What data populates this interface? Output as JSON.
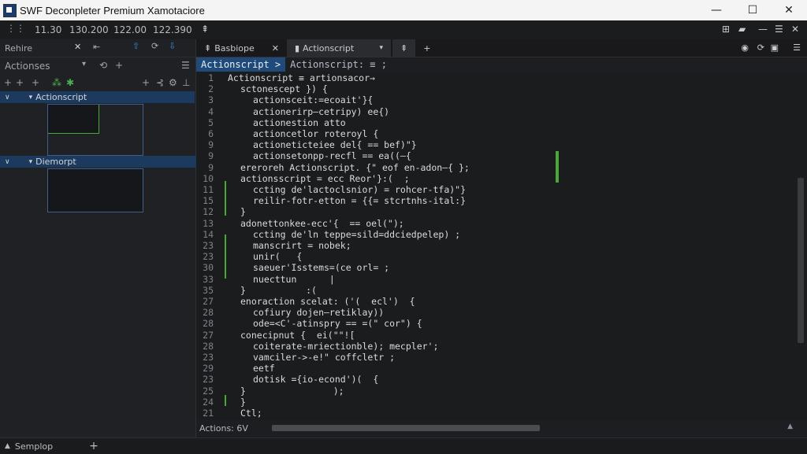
{
  "window": {
    "title": "SWF Deconpleter Premium Xamotaciore",
    "minimize": "—",
    "maximize": "☐",
    "close": "✕"
  },
  "topbar": {
    "t1": "11.30",
    "t2": "130.200",
    "t3": "122.00",
    "t4": "122.390"
  },
  "left_panel": {
    "tab_label": "Rehire",
    "section_label": "Actionses",
    "tree": [
      {
        "label": "Actionscript",
        "selected": true
      },
      {
        "label": "Diemorpt",
        "selected": true
      }
    ]
  },
  "editor": {
    "tabs": [
      {
        "label": "Basbiope"
      },
      {
        "label": "Actionscript"
      }
    ],
    "breadcrumbs": [
      {
        "label": "Actionscript >"
      },
      {
        "label": "Actionscript: ≡ ;"
      }
    ],
    "lines": [
      {
        "n": "1",
        "text": "Actionscript ≡ artionsacor→",
        "indent": 0
      },
      {
        "n": "2",
        "text": "sctonescept }) {",
        "indent": 1
      },
      {
        "n": "3",
        "text": "actionsceit:=ecoait'}{",
        "indent": 2
      },
      {
        "n": "4",
        "text": "actionerirp—cetripy) ee{)",
        "indent": 2
      },
      {
        "n": "5",
        "text": "actionestion atto",
        "indent": 2
      },
      {
        "n": "6",
        "text": "actioncetlor roteroyl {",
        "indent": 2
      },
      {
        "n": "9",
        "text": "actioneticteiee del{ == bef)\"}",
        "indent": 2
      },
      {
        "n": "9",
        "text": "actionsetonpp-recfl == ea((—{",
        "indent": 2
      },
      {
        "n": "9",
        "text": "ereroreh Actionscript. {\" eof en-adon—{ };",
        "indent": 1
      },
      {
        "n": "10",
        "text": "actionsscript = ecc Reor'}:(  ;",
        "indent": 1
      },
      {
        "n": "11",
        "text": "ccting de'lactoclsnior) = rohcer-tfa)\"}",
        "indent": 2
      },
      {
        "n": "15",
        "text": "reilir-fotr-etton = {{= stcrtnhs-ital:}",
        "indent": 2
      },
      {
        "n": "12",
        "text": "}",
        "indent": 1
      },
      {
        "n": "13",
        "text": "adonettonkee-ecc'{  == oel(\");",
        "indent": 1
      },
      {
        "n": "14",
        "text": "ccting de'ln teppe=sild=ddciedpelep) ;",
        "indent": 2
      },
      {
        "n": "23",
        "text": "manscrirt = nobek;",
        "indent": 2
      },
      {
        "n": "23",
        "text": "unir(   {",
        "indent": 2
      },
      {
        "n": "30",
        "text": "saeuer'Isstems=(ce orl= ;",
        "indent": 2
      },
      {
        "n": "33",
        "text": "nuecttun      |",
        "indent": 2
      },
      {
        "n": "35",
        "text": "}           :(",
        "indent": 1
      },
      {
        "n": "27",
        "text": "enoraction scelat: ('(  ecl')  {",
        "indent": 1
      },
      {
        "n": "28",
        "text": "cofiury dojen—retiklay))",
        "indent": 2
      },
      {
        "n": "28",
        "text": "ode=<C'-atinspry == =(\" cor\") {",
        "indent": 2
      },
      {
        "n": "27",
        "text": "conecipnut {  ei(\"\"![",
        "indent": 1
      },
      {
        "n": "28",
        "text": "coiterate-mriectionble); mecpler';",
        "indent": 2
      },
      {
        "n": "23",
        "text": "vamciler->-e!\" coffcletr ;",
        "indent": 2
      },
      {
        "n": "29",
        "text": "eetf",
        "indent": 2
      },
      {
        "n": "23",
        "text": "dotisk ={io-econd')(  {",
        "indent": 2
      },
      {
        "n": "25",
        "text": "}                );",
        "indent": 1
      },
      {
        "n": "24",
        "text": "}",
        "indent": 1
      },
      {
        "n": "21",
        "text": "Ctl;",
        "indent": 1
      }
    ],
    "status_label": "Actions: 6V"
  },
  "statusbar": {
    "label": "Semplop",
    "add": "+"
  }
}
